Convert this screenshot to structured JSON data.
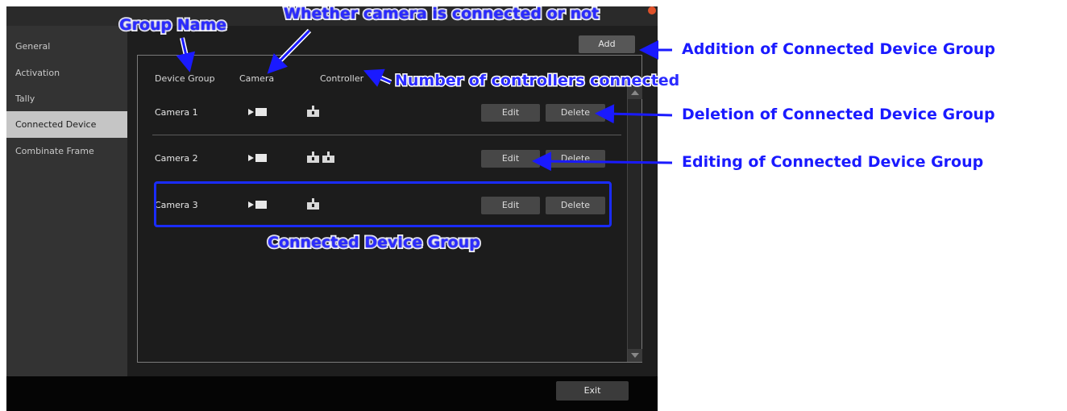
{
  "sidebar": {
    "items": [
      {
        "label": "General"
      },
      {
        "label": "Activation"
      },
      {
        "label": "Tally"
      },
      {
        "label": "Connected Device",
        "active": true
      },
      {
        "label": "Combinate Frame"
      }
    ]
  },
  "toolbar": {
    "add_label": "Add"
  },
  "table": {
    "headers": {
      "group": "Device Group",
      "camera": "Camera",
      "controller": "Controller"
    },
    "rows": [
      {
        "name": "Camera 1",
        "camera_icon": "camera-connected-icon",
        "controllers": 1,
        "edit_label": "Edit",
        "delete_label": "Delete"
      },
      {
        "name": "Camera 2",
        "camera_icon": "camera-connected-icon",
        "controllers": 2,
        "edit_label": "Edit",
        "delete_label": "Delete"
      },
      {
        "name": "Camera 3",
        "camera_icon": "camera-connected-icon",
        "controllers": 1,
        "edit_label": "Edit",
        "delete_label": "Delete"
      }
    ]
  },
  "footer": {
    "exit_label": "Exit"
  },
  "annotations": {
    "group_name": "Group Name",
    "camera_connected": "Whether camera is connected or not",
    "num_controllers": "Number of controllers connected",
    "addition": "Addition of Connected Device Group",
    "deletion": "Deletion of Connected Device Group",
    "editing": "Editing of Connected Device Group",
    "group": "Connected Device Group"
  },
  "colors": {
    "annotation_blue": "#1a1aff",
    "active_sidebar": "#c5c5c5",
    "window_bg": "#1e1e1e"
  }
}
